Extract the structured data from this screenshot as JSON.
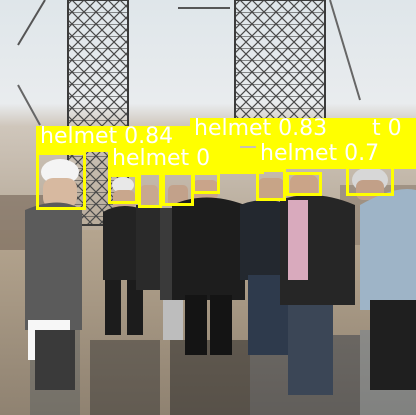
{
  "scene": {
    "description_icon": "construction-site-photo",
    "box_color": "#ffff00",
    "label_text_color": "#ffffff"
  },
  "detections": [
    {
      "label": "helmet 0.84"
    },
    {
      "label": "helmet 0.83"
    },
    {
      "label": "t 0"
    },
    {
      "label": "helmet 0"
    },
    {
      "label": "helmet 0.7"
    },
    {
      "label": ""
    },
    {
      "label": ""
    },
    {
      "label": ""
    },
    {
      "label": ""
    }
  ]
}
